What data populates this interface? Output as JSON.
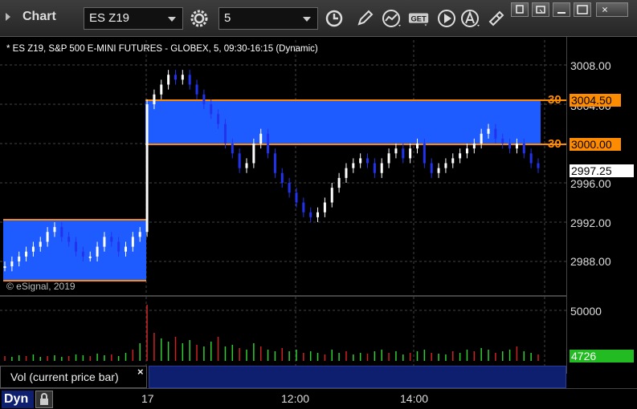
{
  "toolbar": {
    "title": "Chart",
    "symbol": "ES Z19",
    "interval": "5",
    "get_label": "GET"
  },
  "info": {
    "description": "* ES Z19, S&P 500 E-MINI FUTURES - GLOBEX, 5, 09:30-16:15 (Dynamic)",
    "copyright": "© eSignal, 2019"
  },
  "axis": {
    "price_ticks": [
      "3008.00",
      "3004.00",
      "3000.00",
      "2996.00",
      "2992.00",
      "2988.00"
    ],
    "volume_ticks": [
      "50000"
    ],
    "time_labels": [
      "17",
      "12:00",
      "14:00"
    ]
  },
  "levels": {
    "upper": {
      "tag": "30",
      "value": "3004.50"
    },
    "lower": {
      "tag": "30",
      "value": "3000.00"
    },
    "last_price": "2997.25",
    "last_volume": "4726"
  },
  "study": {
    "label": "Vol (current price bar)",
    "close": "×"
  },
  "footer": {
    "dyn": "Dyn"
  },
  "colors": {
    "zone_fill": "#1f5cff",
    "zone_border": "#ff8c00",
    "bar_up": "#ffffff",
    "bar_down": "#2233ee",
    "vol_up": "#33cc33",
    "vol_down": "#cc2222"
  }
}
